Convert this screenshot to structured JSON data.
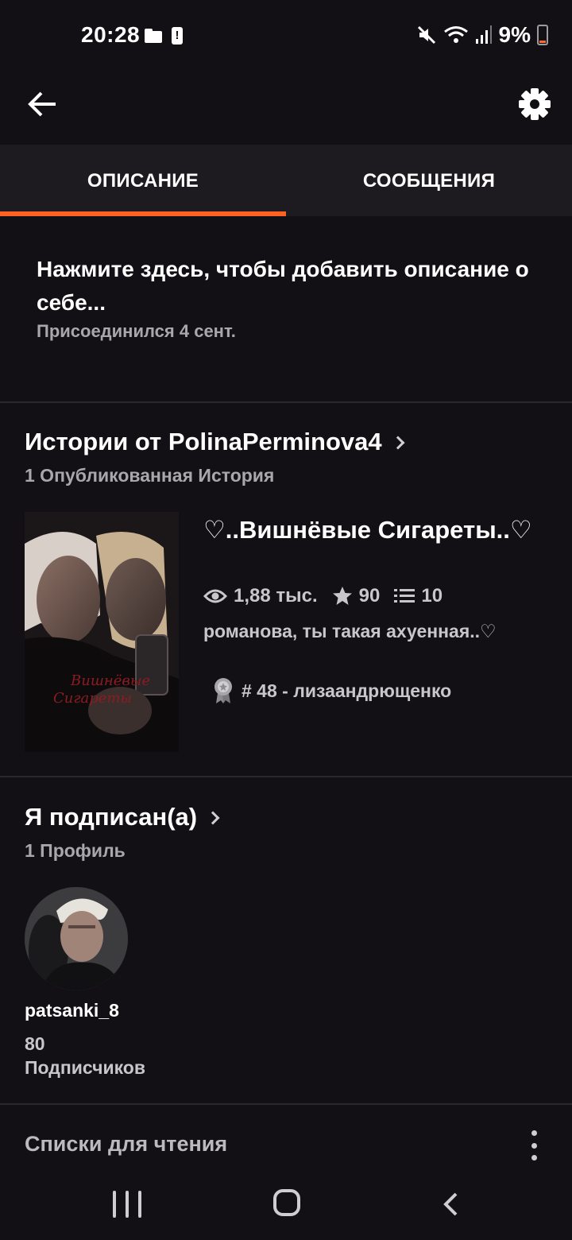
{
  "status_bar": {
    "time": "20:28",
    "battery": "9%",
    "icons": [
      "folder-icon",
      "alert-icon",
      "mute-icon",
      "wifi-icon",
      "signal-icon",
      "battery-icon"
    ]
  },
  "header": {
    "back_icon": "arrow-left-icon",
    "settings_icon": "gear-icon"
  },
  "tabs": [
    {
      "label": "ОПИСАНИЕ",
      "active": true
    },
    {
      "label": "СООБЩЕНИЯ",
      "active": false
    }
  ],
  "about": {
    "prompt": "Нажмите здесь, чтобы добавить описание о себе...",
    "joined": "Присоединился 4 сент."
  },
  "stories": {
    "title": "Истории от PolinaPerminova4",
    "subtitle": "1 Опубликованная История",
    "items": [
      {
        "title": "♡..Вишнёвые Сигареты..♡",
        "reads": "1,88 тыс.",
        "votes": "90",
        "parts": "10",
        "description": "романова, ты такая ахуенная..♡",
        "rank": "# 48 - лизаандрющенко",
        "cover_caption": "Вишнёвые Сигареты"
      }
    ]
  },
  "following": {
    "title": "Я подписан(а)",
    "subtitle": "1 Профиль",
    "profiles": [
      {
        "username": "patsanki_8",
        "followers_count": "80",
        "followers_label": "Подписчиков"
      }
    ]
  },
  "reading_lists": {
    "title": "Списки для чтения"
  },
  "colors": {
    "accent": "#ff6122",
    "background": "#121014",
    "tab_bar": "#1d1b1f"
  }
}
